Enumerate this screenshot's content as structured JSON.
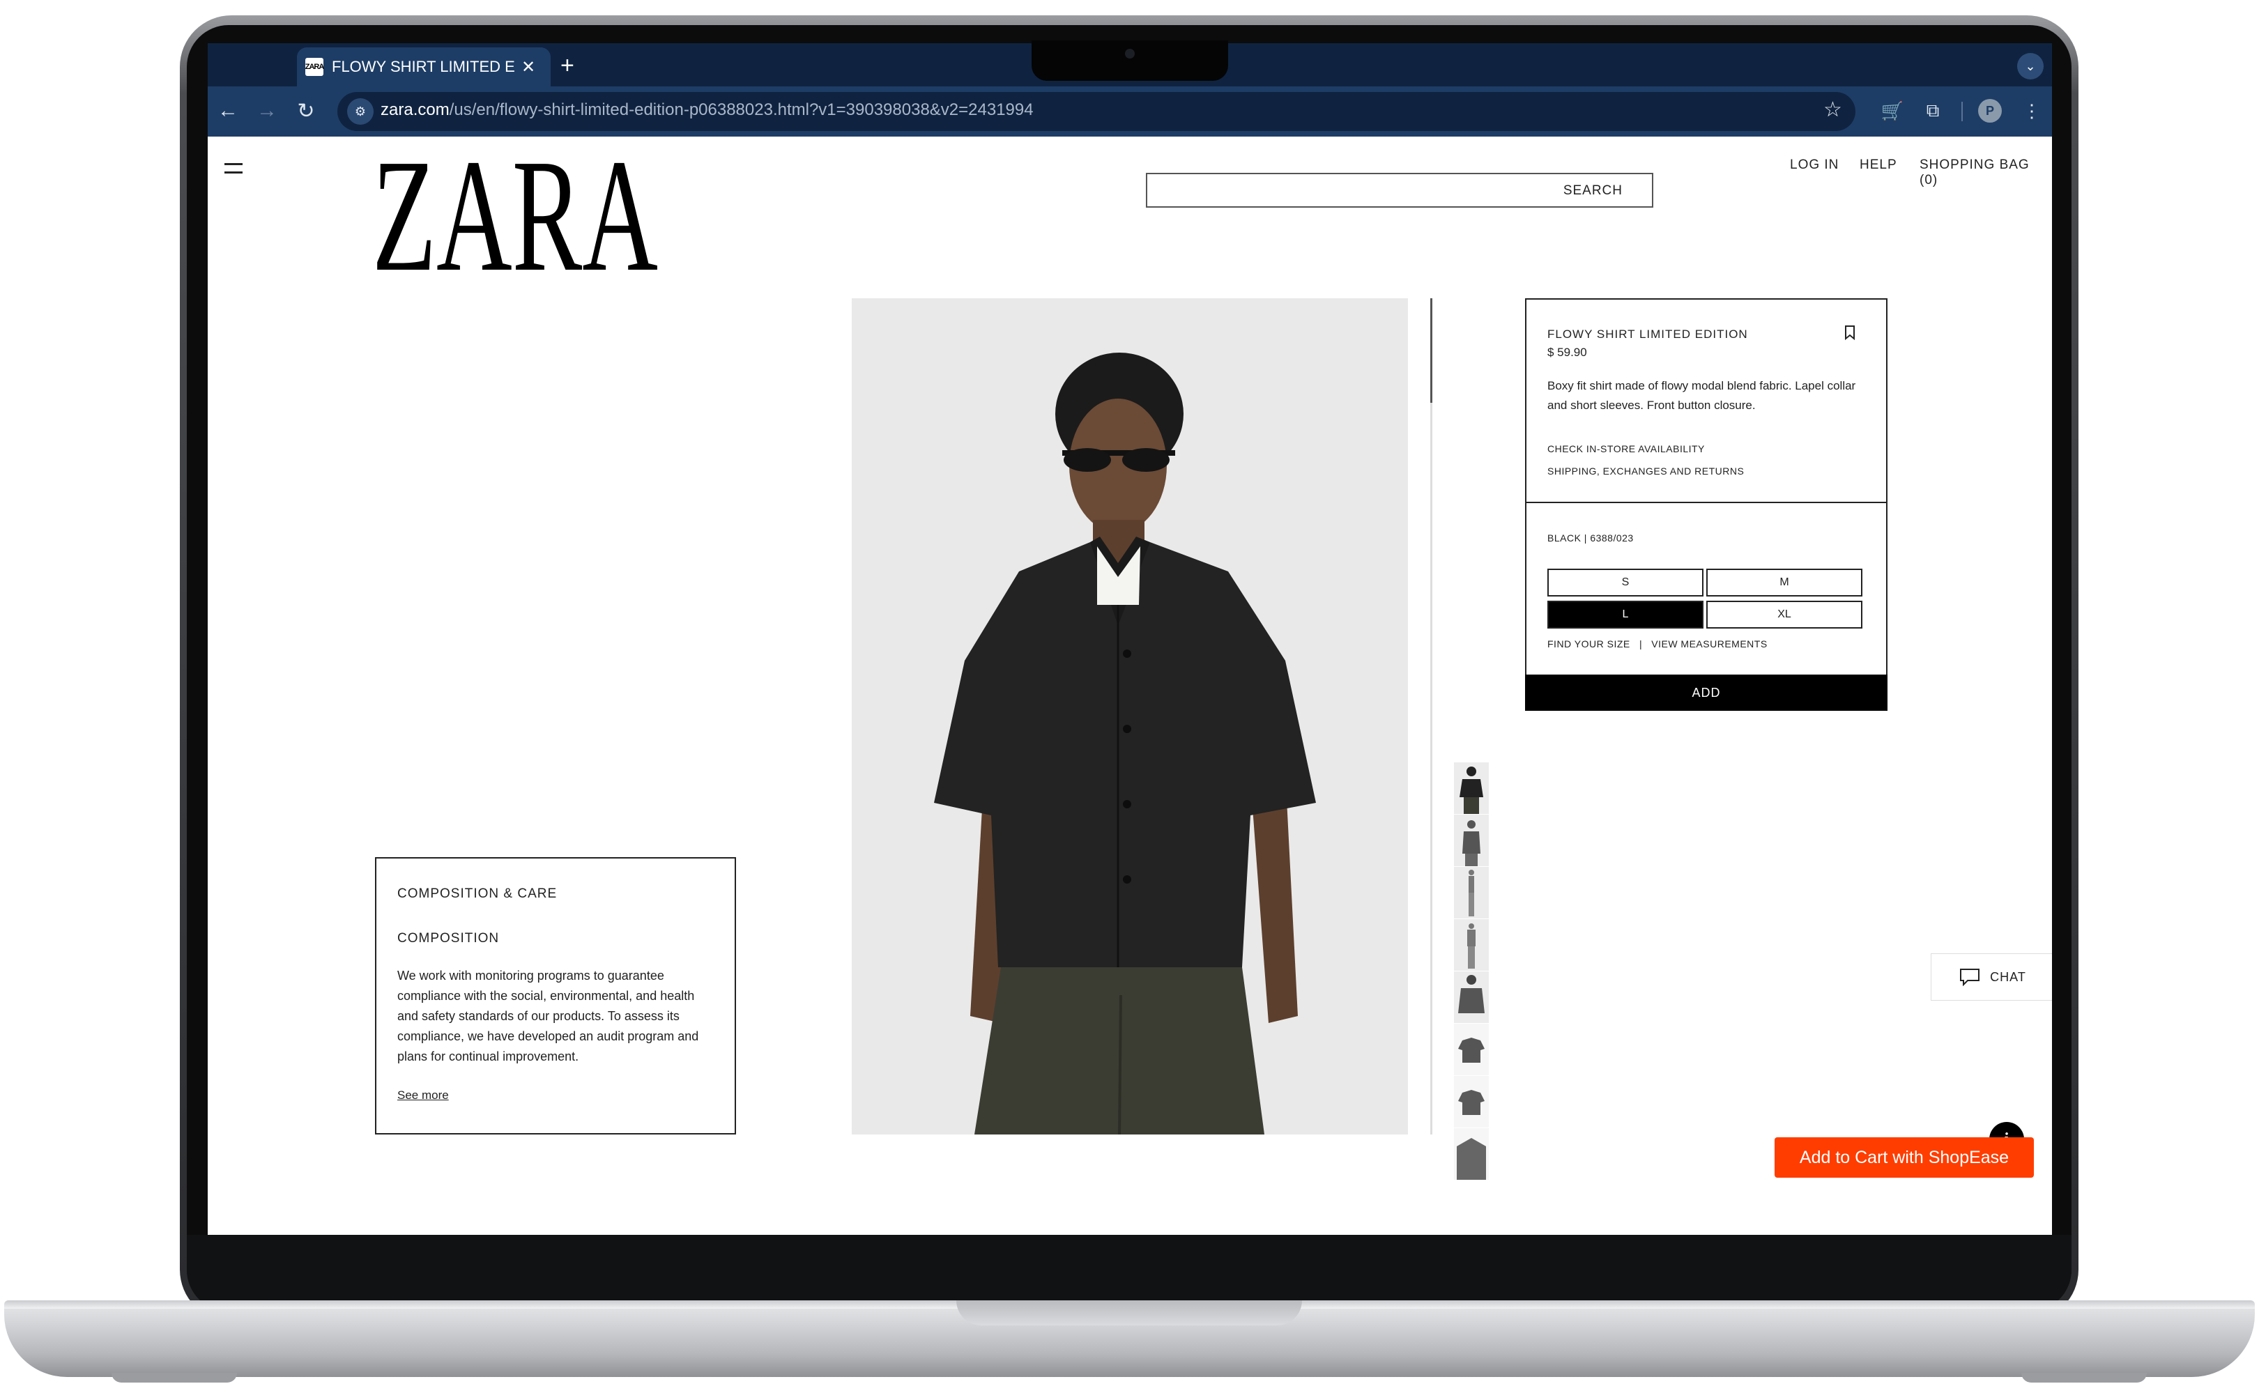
{
  "browser": {
    "tab_title": "FLOWY SHIRT LIMITED EDITI",
    "tab_favicon": "ZARA",
    "url_host": "zara.com",
    "url_path": "/us/en/flowy-shirt-limited-edition-p06388023.html?v1=390398038&v2=2431994",
    "profile_initial": "P",
    "colors": {
      "tabstrip": "#0f2340",
      "toolbar": "#1d3d66"
    }
  },
  "header": {
    "logo_text": "ZARA",
    "search_label": "SEARCH",
    "nav": {
      "login": "LOG IN",
      "help": "HELP",
      "bag": "SHOPPING BAG (0)"
    }
  },
  "composition": {
    "heading": "COMPOSITION & CARE",
    "subheading": "COMPOSITION",
    "body": "We work with monitoring programs to guarantee compliance with the social, environmental, and health and safety standards of our products. To assess its compliance, we have developed an audit program and plans for continual improvement.",
    "see_more": "See more"
  },
  "product": {
    "name": "FLOWY SHIRT LIMITED EDITION",
    "price": "$ 59.90",
    "description": "Boxy fit shirt made of flowy modal blend fabric. Lapel collar and short sleeves. Front button closure.",
    "store_link": "CHECK IN-STORE AVAILABILITY",
    "shipping_link": "SHIPPING, EXCHANGES AND RETURNS",
    "color_code": "BLACK | 6388/023",
    "sizes": [
      "S",
      "M",
      "L",
      "XL"
    ],
    "selected_size": "L",
    "find_size": "FIND YOUR SIZE",
    "size_divider": "|",
    "view_measurements": "VIEW MEASUREMENTS",
    "add_label": "ADD"
  },
  "chat_label": "CHAT",
  "info_badge": "i",
  "shopease_label": "Add to Cart with ShopEase",
  "accent_color": "#ff3d00"
}
